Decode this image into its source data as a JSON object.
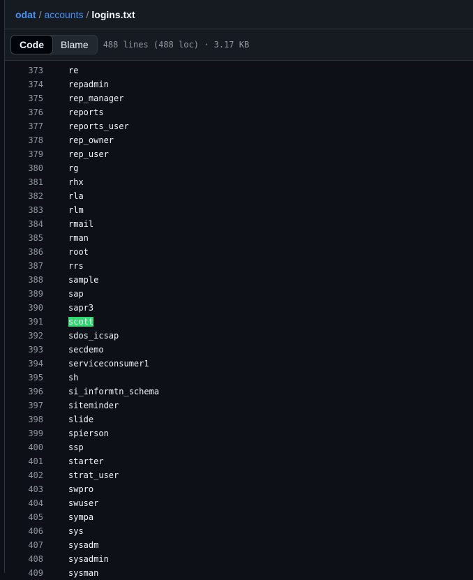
{
  "breadcrumb": {
    "root": "odat",
    "folder": "accounts",
    "file": "logins.txt",
    "separator": "/"
  },
  "toolbar": {
    "code_label": "Code",
    "blame_label": "Blame",
    "meta": "488 lines (488 loc) · 3.17 KB"
  },
  "highlight_color": "#2fd970",
  "lines": [
    {
      "n": "373",
      "t": "re"
    },
    {
      "n": "374",
      "t": "repadmin"
    },
    {
      "n": "375",
      "t": "rep_manager"
    },
    {
      "n": "376",
      "t": "reports"
    },
    {
      "n": "377",
      "t": "reports_user"
    },
    {
      "n": "378",
      "t": "rep_owner"
    },
    {
      "n": "379",
      "t": "rep_user"
    },
    {
      "n": "380",
      "t": "rg"
    },
    {
      "n": "381",
      "t": "rhx"
    },
    {
      "n": "382",
      "t": "rla"
    },
    {
      "n": "383",
      "t": "rlm"
    },
    {
      "n": "384",
      "t": "rmail"
    },
    {
      "n": "385",
      "t": "rman"
    },
    {
      "n": "386",
      "t": "root"
    },
    {
      "n": "387",
      "t": "rrs"
    },
    {
      "n": "388",
      "t": "sample"
    },
    {
      "n": "389",
      "t": "sap"
    },
    {
      "n": "390",
      "t": "sapr3"
    },
    {
      "n": "391",
      "t": "scott",
      "highlight": true
    },
    {
      "n": "392",
      "t": "sdos_icsap"
    },
    {
      "n": "393",
      "t": "secdemo"
    },
    {
      "n": "394",
      "t": "serviceconsumer1"
    },
    {
      "n": "395",
      "t": "sh"
    },
    {
      "n": "396",
      "t": "si_informtn_schema"
    },
    {
      "n": "397",
      "t": "siteminder"
    },
    {
      "n": "398",
      "t": "slide"
    },
    {
      "n": "399",
      "t": "spierson"
    },
    {
      "n": "400",
      "t": "ssp"
    },
    {
      "n": "401",
      "t": "starter"
    },
    {
      "n": "402",
      "t": "strat_user"
    },
    {
      "n": "403",
      "t": "swpro"
    },
    {
      "n": "404",
      "t": "swuser"
    },
    {
      "n": "405",
      "t": "sympa"
    },
    {
      "n": "406",
      "t": "sys"
    },
    {
      "n": "407",
      "t": "sysadm"
    },
    {
      "n": "408",
      "t": "sysadmin"
    },
    {
      "n": "409",
      "t": "sysman"
    }
  ]
}
